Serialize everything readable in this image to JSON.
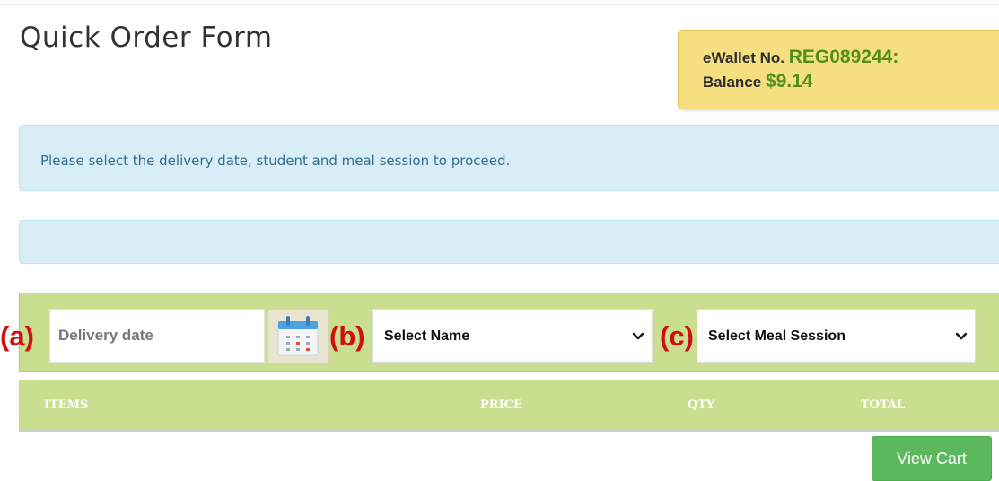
{
  "page": {
    "title": "Quick Order Form"
  },
  "wallet": {
    "label": "eWallet No.",
    "number": "REG089244",
    "separator": ":",
    "balance_label": "Balance",
    "balance_value": "$9.14"
  },
  "alerts": {
    "info_message": "Please select the delivery date, student and meal session to proceed."
  },
  "filters": {
    "date_placeholder": "Delivery date",
    "name_select": {
      "selected": "Select Name"
    },
    "session_select": {
      "selected": "Select Meal Session"
    }
  },
  "annotations": {
    "a": "(a)",
    "b": "(b)",
    "c": "(c)"
  },
  "table": {
    "columns": [
      "ITEMS",
      "PRICE",
      "QTY",
      "TOTAL"
    ]
  },
  "actions": {
    "view_cart": "View Cart"
  },
  "icons": {
    "calendar": "calendar-icon",
    "chevron": "chevron-down-icon"
  },
  "colors": {
    "accent_green": "#5cb85c",
    "filter_bar": "#c9de8f",
    "wallet_bg": "#f5df80",
    "info_bg": "#d9edf7",
    "info_text": "#31708f",
    "annotation_red": "#d01010"
  }
}
